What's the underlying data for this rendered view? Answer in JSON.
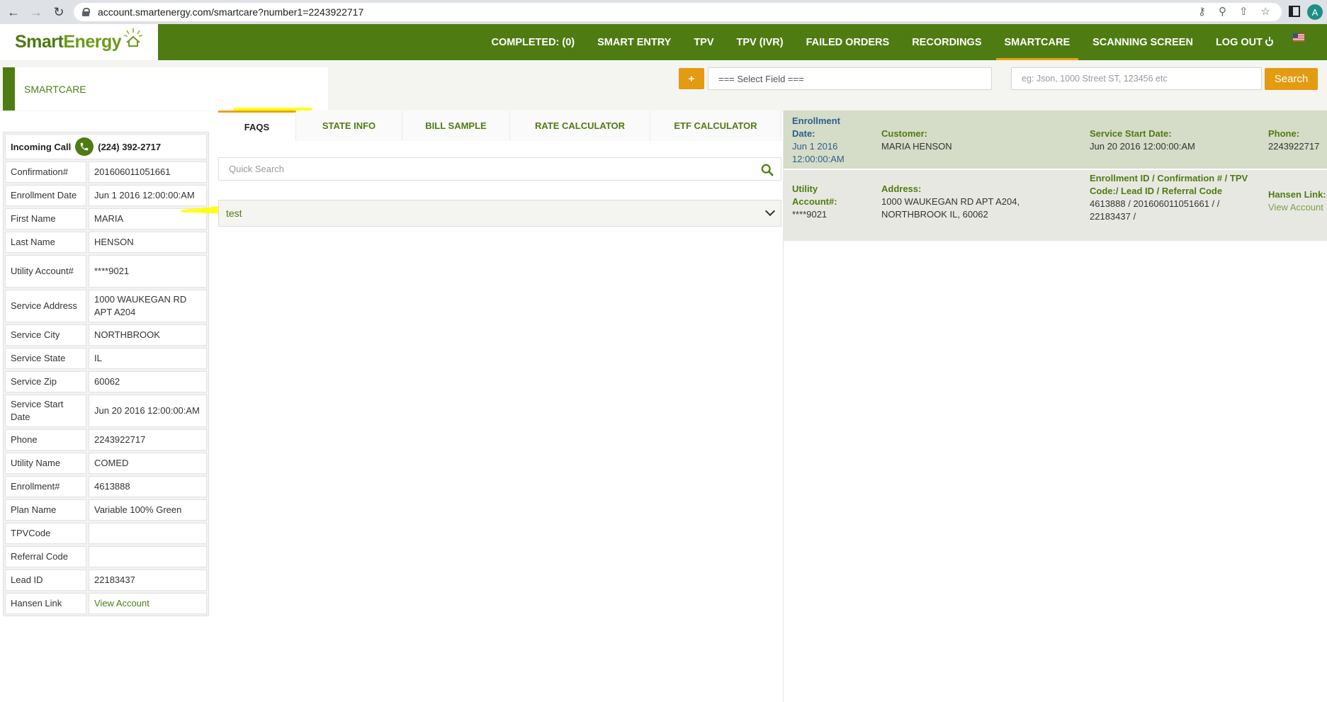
{
  "browser": {
    "url": "account.smartenergy.com/smartcare?number1=2243922717",
    "profile_initial": "A"
  },
  "header": {
    "logo": {
      "main": "Smart",
      "accent": "Energy"
    },
    "nav": [
      {
        "label": "COMPLETED: (0)"
      },
      {
        "label": "SMART ENTRY"
      },
      {
        "label": "TPV"
      },
      {
        "label": "TPV (IVR)"
      },
      {
        "label": "FAILED ORDERS"
      },
      {
        "label": "RECORDINGS"
      },
      {
        "label": "SMARTCARE",
        "active": true
      },
      {
        "label": "SCANNING SCREEN"
      },
      {
        "label": "LOG OUT"
      }
    ],
    "colors": {
      "brand_green": "#4e7c12",
      "accent_orange": "#e39b12"
    }
  },
  "page": {
    "section_title": "SMARTCARE",
    "add_button": "+",
    "select_field": "=== Select Field ===",
    "search_placeholder": "eg: Json, 1000 Street ST, 123456 etc",
    "search_button": "Search"
  },
  "customer": {
    "incoming_label": "Incoming Call",
    "incoming_number": "(224) 392-2717",
    "rows": [
      {
        "label": "Confirmation#",
        "value": "201606011051661"
      },
      {
        "label": "Enrollment Date",
        "value": "Jun 1 2016 12:00:00:AM"
      },
      {
        "label": "First Name",
        "value": "MARIA"
      },
      {
        "label": "Last Name",
        "value": "HENSON"
      },
      {
        "label": "Utility Account#",
        "value": "****9021"
      },
      {
        "label": "Service Address",
        "value": "1000 WAUKEGAN RD APT A204"
      },
      {
        "label": "Service City",
        "value": "NORTHBROOK"
      },
      {
        "label": "Service State",
        "value": "IL"
      },
      {
        "label": "Service Zip",
        "value": "60062"
      },
      {
        "label": "Service Start Date",
        "value": "Jun 20 2016 12:00:00:AM"
      },
      {
        "label": "Phone",
        "value": "2243922717"
      },
      {
        "label": "Utility Name",
        "value": "COMED"
      },
      {
        "label": "Enrollment#",
        "value": "4613888"
      },
      {
        "label": "Plan Name",
        "value": "Variable 100% Green"
      },
      {
        "label": "TPVCode",
        "value": ""
      },
      {
        "label": "Referral Code",
        "value": ""
      },
      {
        "label": "Lead ID",
        "value": "22183437"
      },
      {
        "label": "Hansen Link",
        "value": "View Account"
      }
    ]
  },
  "tabs": [
    {
      "label": "FAQS",
      "active": true
    },
    {
      "label": "STATE INFO"
    },
    {
      "label": "BILL SAMPLE"
    },
    {
      "label": "RATE CALCULATOR"
    },
    {
      "label": "ETF CALCULATOR"
    }
  ],
  "faq": {
    "quick_search_placeholder": "Quick Search",
    "accordion_item": "test"
  },
  "summary": {
    "enrollment_date_label": "Enrollment Date:",
    "enrollment_date_value": "Jun 1 2016 12:00:00:AM",
    "customer_label": "Customer:",
    "customer_value": "MARIA HENSON",
    "service_start_label": "Service Start Date:",
    "service_start_value": "Jun 20 2016 12:00:00:AM",
    "phone_label": "Phone:",
    "phone_value": "2243922717",
    "utility_account_label": "Utility Account#:",
    "utility_account_value": "****9021",
    "address_label": "Address:",
    "address_value": "1000 WAUKEGAN RD APT A204, NORTHBROOK IL, 60062",
    "ids_label": "Enrollment ID / Confirmation # / TPV Code:/ Lead ID / Referral Code",
    "ids_value": "4613888 / 201606011051661 / / 22183437 /",
    "hansen_label": "Hansen Link:",
    "hansen_value": "View Account"
  }
}
